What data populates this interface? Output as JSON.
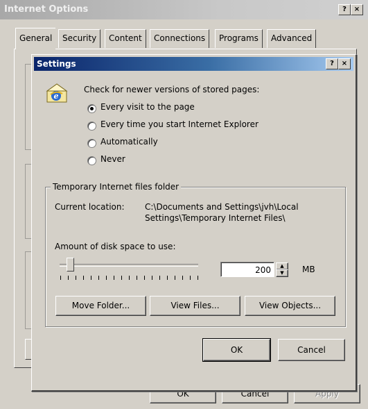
{
  "outer": {
    "title": "Internet Options",
    "help": "?",
    "close": "×",
    "tabs": [
      "General",
      "Security",
      "Content",
      "Connections",
      "Programs",
      "Advanced"
    ],
    "buttons": {
      "ok": "OK",
      "cancel": "Cancel",
      "apply": "Apply"
    }
  },
  "settings": {
    "title": "Settings",
    "help": "?",
    "close": "×",
    "check_heading": "Check for newer versions of stored pages:",
    "options": [
      {
        "label": "Every visit to the page",
        "checked": true
      },
      {
        "label": "Every time you start Internet Explorer",
        "checked": false
      },
      {
        "label": "Automatically",
        "checked": false
      },
      {
        "label": "Never",
        "checked": false
      }
    ],
    "group_title": "Temporary Internet files folder",
    "current_location_label": "Current location:",
    "current_location_line1": "C:\\Documents and Settings\\jvh\\Local",
    "current_location_line2": "Settings\\Temporary Internet Files\\",
    "disk_space_label": "Amount of disk space to use:",
    "disk_space_value": "200",
    "disk_space_unit": "MB",
    "slider_level": 0.05,
    "buttons": {
      "move_folder": "Move Folder...",
      "view_files": "View Files...",
      "view_objects": "View Objects...",
      "ok": "OK",
      "cancel": "Cancel"
    }
  }
}
